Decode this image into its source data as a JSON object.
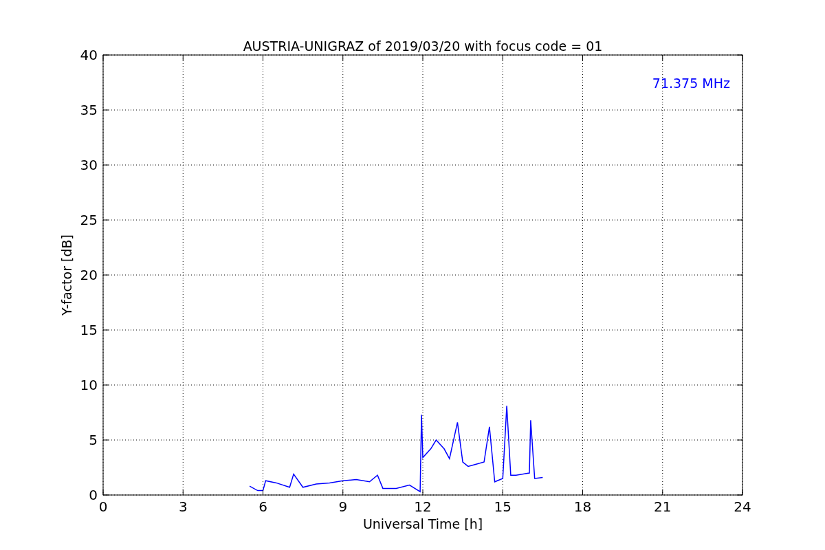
{
  "chart_data": {
    "type": "line",
    "title": "AUSTRIA-UNIGRAZ of 2019/03/20 with focus code = 01",
    "xlabel": "Universal Time [h]",
    "ylabel": "Y-factor [dB]",
    "x": [
      5.5,
      5.8,
      6.0,
      6.1,
      6.5,
      7.0,
      7.15,
      7.5,
      8.0,
      8.5,
      9.0,
      9.5,
      10.0,
      10.3,
      10.5,
      11.0,
      11.5,
      11.9,
      11.95,
      12.0,
      12.3,
      12.5,
      12.8,
      13.0,
      13.3,
      13.5,
      13.7,
      14.0,
      14.3,
      14.5,
      14.7,
      15.0,
      15.15,
      15.3,
      15.5,
      16.0,
      16.05,
      16.2,
      16.5
    ],
    "series": [
      {
        "name": "71.375 MHz",
        "color": "#0000ff",
        "values": [
          0.8,
          0.4,
          0.4,
          1.3,
          1.1,
          0.7,
          1.9,
          0.7,
          1.0,
          1.1,
          1.3,
          1.4,
          1.2,
          1.8,
          0.6,
          0.6,
          0.9,
          0.3,
          7.3,
          3.4,
          4.2,
          5.0,
          4.2,
          3.3,
          6.6,
          3.0,
          2.6,
          2.8,
          3.0,
          6.2,
          1.2,
          1.5,
          8.1,
          1.8,
          1.8,
          2.0,
          6.8,
          1.5,
          1.6
        ]
      }
    ],
    "xlim": [
      0,
      24
    ],
    "ylim": [
      0,
      40
    ],
    "xticks": [
      0,
      3,
      6,
      9,
      12,
      15,
      18,
      21,
      24
    ],
    "yticks": [
      0,
      5,
      10,
      15,
      20,
      25,
      30,
      35,
      40
    ],
    "grid": true
  }
}
